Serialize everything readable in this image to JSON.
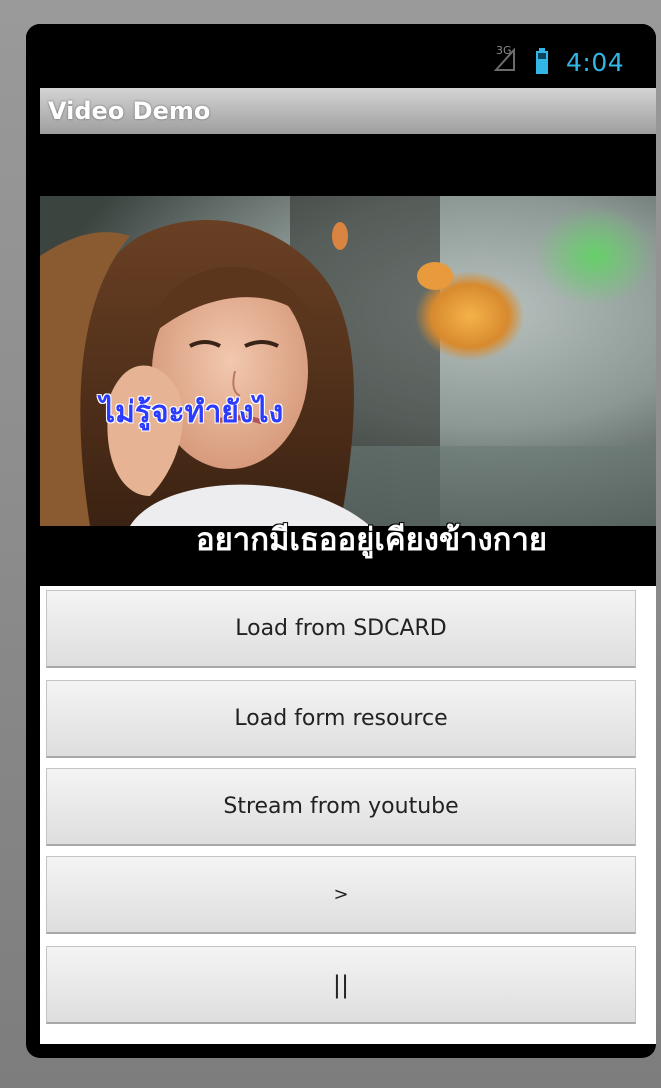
{
  "status_bar": {
    "network_label": "3G",
    "time": "4:04",
    "icons": [
      "signal-icon",
      "battery-icon"
    ],
    "time_color": "#33b5e5"
  },
  "app_bar": {
    "title": "Video Demo"
  },
  "video": {
    "subtitle_line1": "ไม่รู้จะทำยังไง",
    "subtitle_line2": "อยากมีเธออยู่เคียงข้างกาย"
  },
  "buttons": {
    "load_sdcard": "Load from SDCARD",
    "load_resource": "Load form resource",
    "stream_youtube": "Stream from youtube",
    "play": ">",
    "pause": "||"
  }
}
